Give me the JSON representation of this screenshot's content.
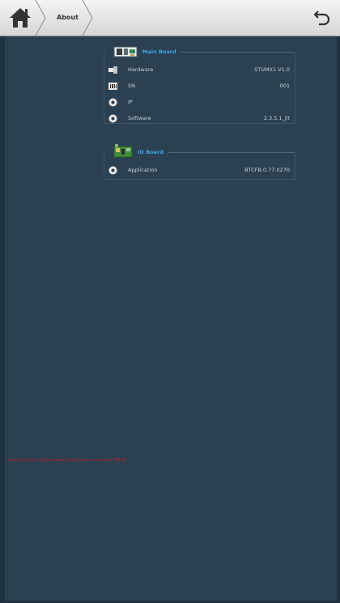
{
  "header": {
    "breadcrumb_label": "About"
  },
  "main_board": {
    "title": "Main Board",
    "rows": [
      {
        "label": "Hardware",
        "value": "STUMX1 V1.0",
        "icon": "usb-icon"
      },
      {
        "label": "SN",
        "value": "001",
        "icon": "barcode-icon"
      },
      {
        "label": "IP",
        "value": "",
        "icon": "gear-icon"
      },
      {
        "label": "Software",
        "value": "2.3.5.1_jlt",
        "icon": "gear-icon"
      }
    ]
  },
  "io_board": {
    "title": "IO Board",
    "rows": [
      {
        "label": "Application",
        "value": "BTCFB.0.77.0270",
        "icon": "gear-icon"
      }
    ]
  },
  "warning": {
    "text": "Iecas firmver region  wesrmvde firmes  nennber  FMI B"
  },
  "colors": {
    "background": "#2b4152",
    "accent": "#3fa6e8",
    "warning": "#c0182a"
  }
}
